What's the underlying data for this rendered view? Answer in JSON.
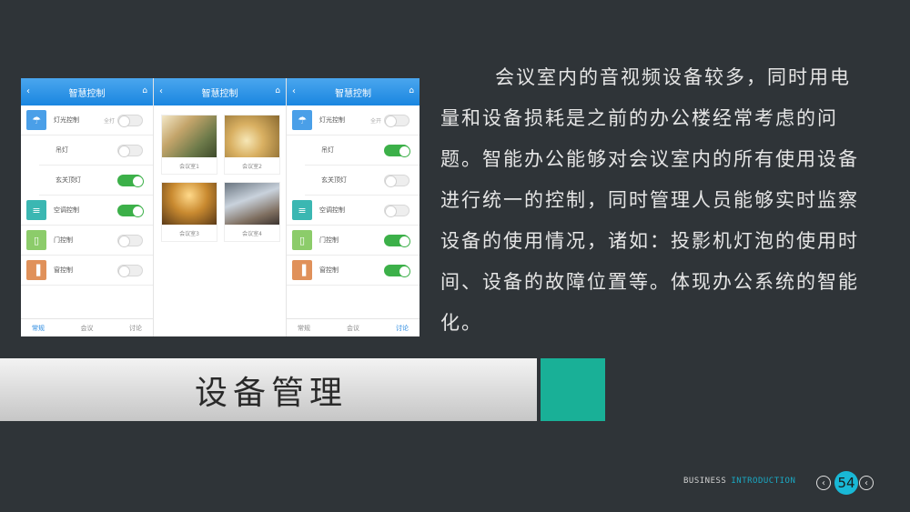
{
  "phones": [
    {
      "title": "智慧控制",
      "rows": [
        {
          "icon": "lamp-icon",
          "label": "灯光控制",
          "tag": "全打",
          "on": false,
          "sub": false,
          "color": "blue"
        },
        {
          "icon": "",
          "label": "吊灯",
          "tag": "",
          "on": false,
          "sub": true,
          "color": ""
        },
        {
          "icon": "",
          "label": "玄关顶灯",
          "tag": "",
          "on": true,
          "sub": true,
          "color": ""
        },
        {
          "icon": "aircon-icon",
          "label": "空调控制",
          "tag": "",
          "on": true,
          "sub": false,
          "color": "teal"
        },
        {
          "icon": "door-icon",
          "label": "门控制",
          "tag": "",
          "on": false,
          "sub": false,
          "color": "green"
        },
        {
          "icon": "curtain-icon",
          "label": "窗控制",
          "tag": "",
          "on": false,
          "sub": false,
          "color": "orange"
        }
      ],
      "tabs": [
        "常规",
        "会议",
        "讨论"
      ],
      "active_tab": 0
    },
    {
      "title": "智慧控制",
      "rooms": [
        "会议室1",
        "会议室2",
        "会议室3",
        "会议室4"
      ]
    },
    {
      "title": "智慧控制",
      "rows": [
        {
          "icon": "lamp-icon",
          "label": "灯光控制",
          "tag": "全开",
          "on": false,
          "sub": false,
          "color": "blue"
        },
        {
          "icon": "",
          "label": "吊灯",
          "tag": "",
          "on": true,
          "sub": true,
          "color": ""
        },
        {
          "icon": "",
          "label": "玄关顶灯",
          "tag": "",
          "on": false,
          "sub": true,
          "color": ""
        },
        {
          "icon": "aircon-icon",
          "label": "空调控制",
          "tag": "",
          "on": false,
          "sub": false,
          "color": "teal"
        },
        {
          "icon": "door-icon",
          "label": "门控制",
          "tag": "",
          "on": true,
          "sub": false,
          "color": "green"
        },
        {
          "icon": "curtain-icon",
          "label": "窗控制",
          "tag": "",
          "on": true,
          "sub": false,
          "color": "orange"
        }
      ],
      "tabs": [
        "常规",
        "会议",
        "讨论"
      ],
      "active_tab": 2
    }
  ],
  "paragraph": "会议室内的音视频设备较多，同时用电量和设备损耗是之前的办公楼经常考虑的问题。智能办公能够对会议室内的所有使用设备进行统一的控制，同时管理人员能够实时监察设备的使用情况，诸如：投影机灯泡的使用时间、设备的故障位置等。体现办公系统的智能化。",
  "section_title": "设备管理",
  "footer": {
    "word1": "BUSINESS",
    "word2": "INTRODUCTION",
    "page_number": "54"
  },
  "colors": {
    "background": "#2f3438",
    "accent_teal": "#19b097",
    "accent_cyan": "#19b8d6",
    "phone_header": "#1a86e0",
    "toggle_on": "#3cb049"
  }
}
